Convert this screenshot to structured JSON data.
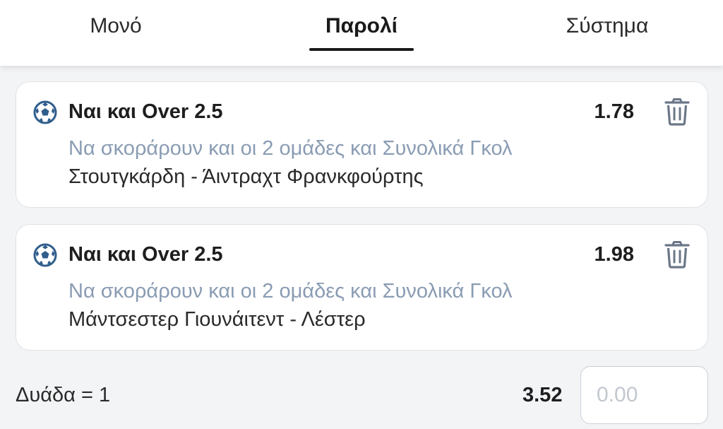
{
  "tabs": [
    {
      "label": "Μονό"
    },
    {
      "label": "Παρολί"
    },
    {
      "label": "Σύστημα"
    }
  ],
  "active_tab": "Παρολί",
  "selections": [
    {
      "title": "Ναι και Over 2.5",
      "odds": "1.78",
      "market": "Να σκοράρουν και οι 2 ομάδες και Συνολικά Γκολ",
      "event": "Στουτγκάρδη - Άιντραχτ Φρανκφούρτης",
      "icon": "soccer-ball-icon"
    },
    {
      "title": "Ναι και Over 2.5",
      "odds": "1.98",
      "market": "Να σκοράρουν και οι 2 ομάδες και Συνολικά Γκολ",
      "event": "Μάντσεστερ Γιουνάιτεντ - Λέστερ",
      "icon": "soccer-ball-icon"
    }
  ],
  "footer": {
    "combo_label": "Δυάδα = 1",
    "total_odds": "3.52",
    "stake_placeholder": "0.00"
  },
  "colors": {
    "accent": "#1a1a1a",
    "market_text": "#8a9cb3",
    "icon_blue": "#2f5d8c",
    "background": "#f3f4f6"
  }
}
